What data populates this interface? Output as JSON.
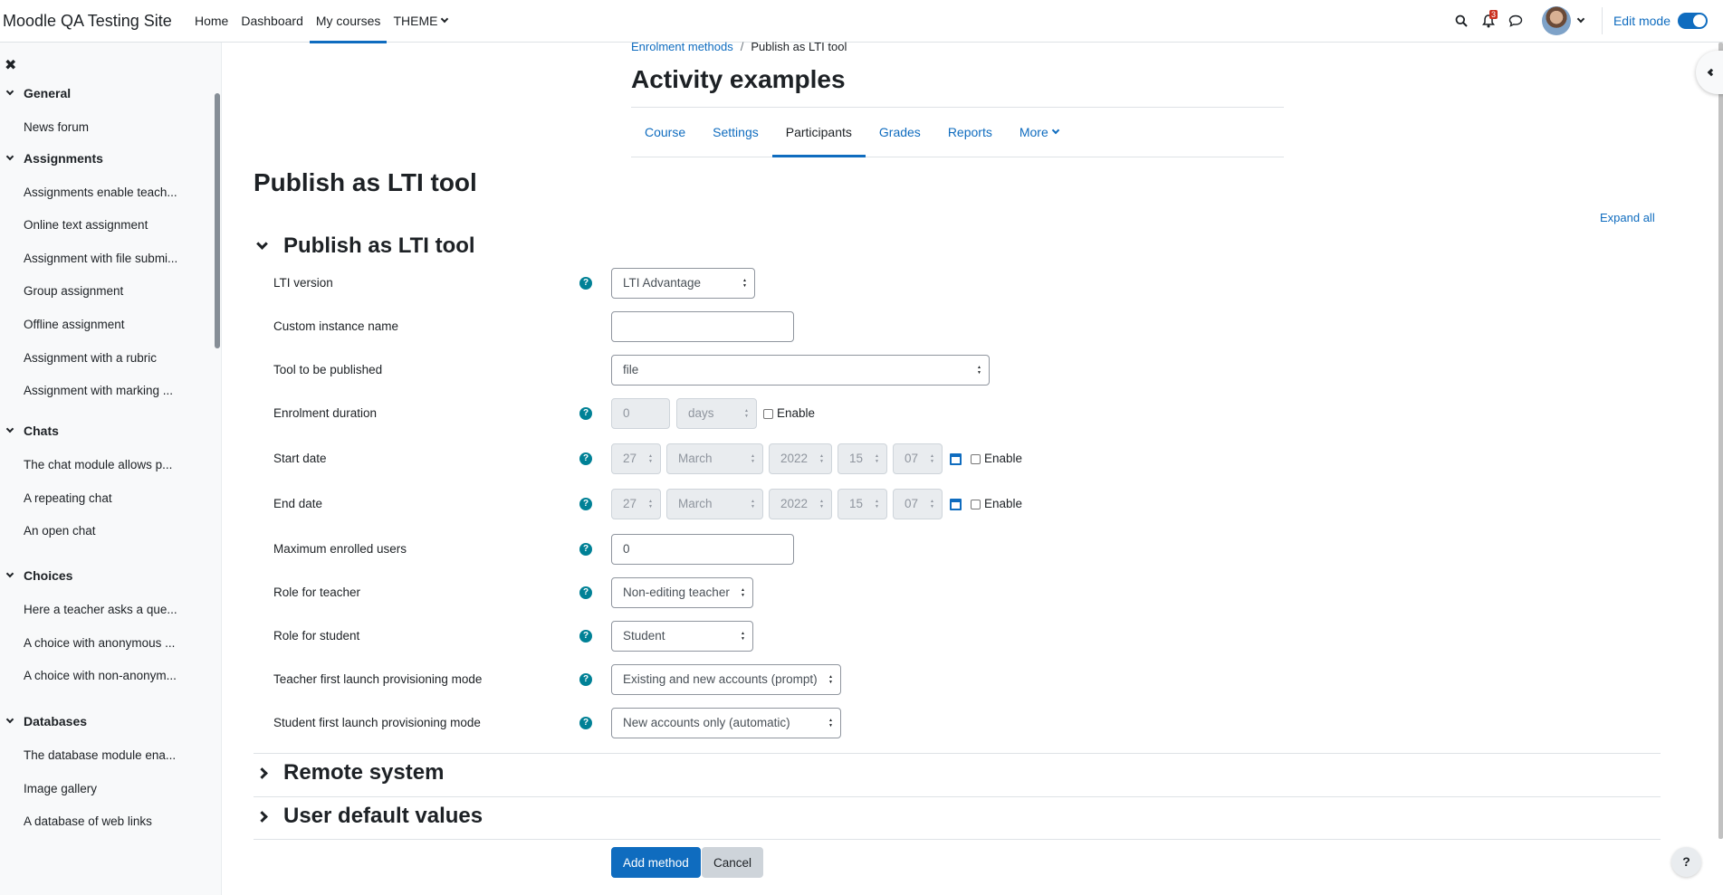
{
  "navbar": {
    "site_name": "Moodle QA Testing Site",
    "items": [
      {
        "label": "Home"
      },
      {
        "label": "Dashboard"
      },
      {
        "label": "My courses"
      },
      {
        "label": "THEME"
      }
    ],
    "active_item": "My courses",
    "notification_count": "3",
    "edit_mode_label": "Edit mode",
    "edit_mode_on": true
  },
  "drawer": {
    "sections": [
      {
        "title": "General",
        "items": [
          "News forum"
        ]
      },
      {
        "title": "Assignments",
        "items": [
          "Assignments enable teach...",
          "Online text assignment",
          "Assignment with file submi...",
          "Group assignment",
          "Offline assignment",
          "Assignment with a rubric",
          "Assignment with marking ..."
        ]
      },
      {
        "title": "Chats",
        "items": [
          "The chat module allows p...",
          "A repeating chat",
          "An open chat"
        ]
      },
      {
        "title": "Choices",
        "items": [
          "Here a teacher asks a que...",
          "A choice with anonymous ...",
          "A choice with non-anonym..."
        ]
      },
      {
        "title": "Databases",
        "items": [
          "The database module ena...",
          "Image gallery",
          "A database of web links"
        ]
      }
    ]
  },
  "breadcrumb": {
    "parent": "Enrolment methods",
    "current": "Publish as LTI tool"
  },
  "course_title": "Activity examples",
  "secondary_nav": [
    {
      "label": "Course"
    },
    {
      "label": "Settings"
    },
    {
      "label": "Participants"
    },
    {
      "label": "Grades"
    },
    {
      "label": "Reports"
    },
    {
      "label": "More"
    }
  ],
  "page_heading": "Publish as LTI tool",
  "expand_all": "Expand all",
  "fieldsets": {
    "main": "Publish as LTI tool",
    "remote": "Remote system",
    "defaults": "User default values"
  },
  "form": {
    "lti_version": {
      "label": "LTI version",
      "value": "LTI Advantage"
    },
    "custom_name": {
      "label": "Custom instance name",
      "value": ""
    },
    "tool": {
      "label": "Tool to be published",
      "value": "file"
    },
    "enrol_duration": {
      "label": "Enrolment duration",
      "number": "0",
      "unit": "days",
      "enable": "Enable"
    },
    "start_date": {
      "label": "Start date",
      "day": "27",
      "month": "March",
      "year": "2022",
      "hour": "15",
      "minute": "07",
      "enable": "Enable"
    },
    "end_date": {
      "label": "End date",
      "day": "27",
      "month": "March",
      "year": "2022",
      "hour": "15",
      "minute": "07",
      "enable": "Enable"
    },
    "max_users": {
      "label": "Maximum enrolled users",
      "value": "0"
    },
    "role_teacher": {
      "label": "Role for teacher",
      "value": "Non-editing teacher"
    },
    "role_student": {
      "label": "Role for student",
      "value": "Student"
    },
    "teacher_prov": {
      "label": "Teacher first launch provisioning mode",
      "value": "Existing and new accounts (prompt)"
    },
    "student_prov": {
      "label": "Student first launch provisioning mode",
      "value": "New accounts only (automatic)"
    }
  },
  "buttons": {
    "add": "Add method",
    "cancel": "Cancel"
  },
  "help_fab": "?"
}
